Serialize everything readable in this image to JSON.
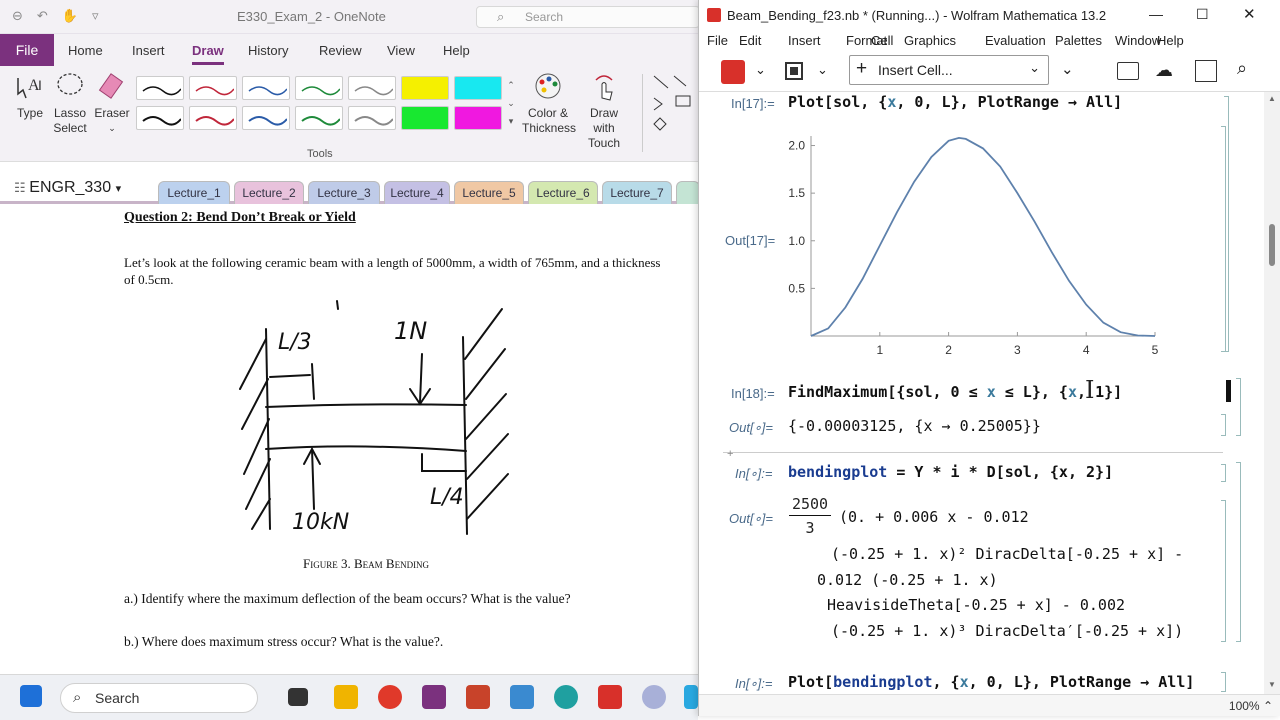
{
  "onenote": {
    "doc_title": "E330_Exam_2 - OneNote",
    "search_placeholder": "Search",
    "tabs": [
      "File",
      "Home",
      "Insert",
      "Draw",
      "History",
      "Review",
      "View",
      "Help"
    ],
    "active_tab": "Draw",
    "tools": {
      "type": "Type",
      "lasso": "Lasso Select",
      "eraser": "Eraser",
      "color": "Color & Thickness",
      "draw_touch": "Draw with Touch",
      "group_label": "Tools"
    },
    "notebook": "ENGR_330",
    "sections": [
      "Lecture_1",
      "Lecture_2",
      "Lecture_3",
      "Lecture_4",
      "Lecture_5",
      "Lecture_6",
      "Lecture_7"
    ],
    "section_colors": [
      "#bcd1ee",
      "#e8c2dc",
      "#bfcbe8",
      "#c4c0e4",
      "#f0c8a4",
      "#d4e8b0",
      "#b8dbe8"
    ],
    "page": {
      "title": "Question 2: Bend Don’t Break or Yield",
      "intro": "Let’s look at the following ceramic beam with a length of 5000mm, a width of 765mm, and a thickness of 0.5cm.",
      "sketch": {
        "l3": "L/3",
        "f1": "1N",
        "f2": "10kN",
        "l4": "L/4"
      },
      "caption": "Figure 3. Beam Bending",
      "qa": "a.) Identify where the maximum deflection of the beam occurs? What is the value?",
      "qb": "b.) Where does maximum stress occur? What is the value?."
    }
  },
  "mathematica": {
    "title": "Beam_Bending_f23.nb * (Running...) - Wolfram Mathematica 13.2",
    "menu": [
      "File",
      "Edit",
      "Insert",
      "Format",
      "Cell",
      "Graphics",
      "Evaluation",
      "Palettes",
      "Window",
      "Help"
    ],
    "insert_cell": "Insert Cell...",
    "zoom": "100%",
    "cells": {
      "in17": "In[17]:=",
      "out17": "Out[17]=",
      "in18": "In[18]:=",
      "out18": "Out[",
      "in19": "In[",
      "out19": "Out[",
      "in20": "In[",
      "dot": "∘",
      "close": "]:=",
      "close_out": "]="
    },
    "plot_cmd": {
      "fn": "Plot",
      "a": "[",
      "sol": "sol",
      ", {": ", {",
      "x": "x",
      ",0,": ", 0, ",
      "L": "L",
      "rest": "}, PlotRange → All]"
    },
    "find_max": {
      "fn": "FindMaximum",
      "a": "[{",
      "sol": "sol",
      ", 0 ≤ ": ", 0 ≤ ",
      "x": "x",
      " ≤ L}, {": " ≤ L}, {",
      "x2": "x",
      ", ": ", ",
      "n": "1",
      "end": "}]"
    },
    "out18_text": "{-0.00003125, {x → 0.25005}}",
    "bend_cmd": {
      "name": "bendingplot",
      "mid": " = Y * i * D[sol, {x, 2}]"
    },
    "out19": {
      "num": "2500",
      "den": "3",
      "l1": "(0. + 0.006 x - 0.012",
      "l2": "(-0.25 + 1. x)² DiracDelta[-0.25 + x] -",
      "l3": "0.012 (-0.25 + 1. x)",
      "l4": "HeavisideTheta[-0.25 + x] - 0.002",
      "l5": "(-0.25 + 1. x)³ DiracDelta′[-0.25 + x])"
    },
    "plot2_cmd": {
      "fn": "Plot",
      "a": "[",
      "name": "bendingplot",
      ", {": ", {",
      "x": "x",
      "rest": ", 0, L}, PlotRange → All]"
    }
  },
  "chart_data": {
    "type": "line",
    "title": "",
    "xlabel": "",
    "ylabel": "",
    "xlim": [
      0,
      5
    ],
    "ylim": [
      0,
      2.1
    ],
    "x_ticks": [
      1,
      2,
      3,
      4,
      5
    ],
    "y_ticks": [
      0.5,
      1.0,
      1.5,
      2.0
    ],
    "series": [
      {
        "x": [
          0,
          0.25,
          0.5,
          0.75,
          1,
          1.25,
          1.5,
          1.75,
          2,
          2.15,
          2.25,
          2.5,
          2.75,
          3,
          3.25,
          3.5,
          3.75,
          4,
          4.25,
          4.5,
          4.75,
          5
        ],
        "y": [
          0,
          0.08,
          0.3,
          0.6,
          0.95,
          1.3,
          1.62,
          1.88,
          2.05,
          2.08,
          2.07,
          1.97,
          1.78,
          1.5,
          1.2,
          0.88,
          0.58,
          0.33,
          0.14,
          0.04,
          0.005,
          0
        ]
      }
    ],
    "color": "#5e81ac"
  },
  "taskbar": {
    "search": "Search"
  }
}
